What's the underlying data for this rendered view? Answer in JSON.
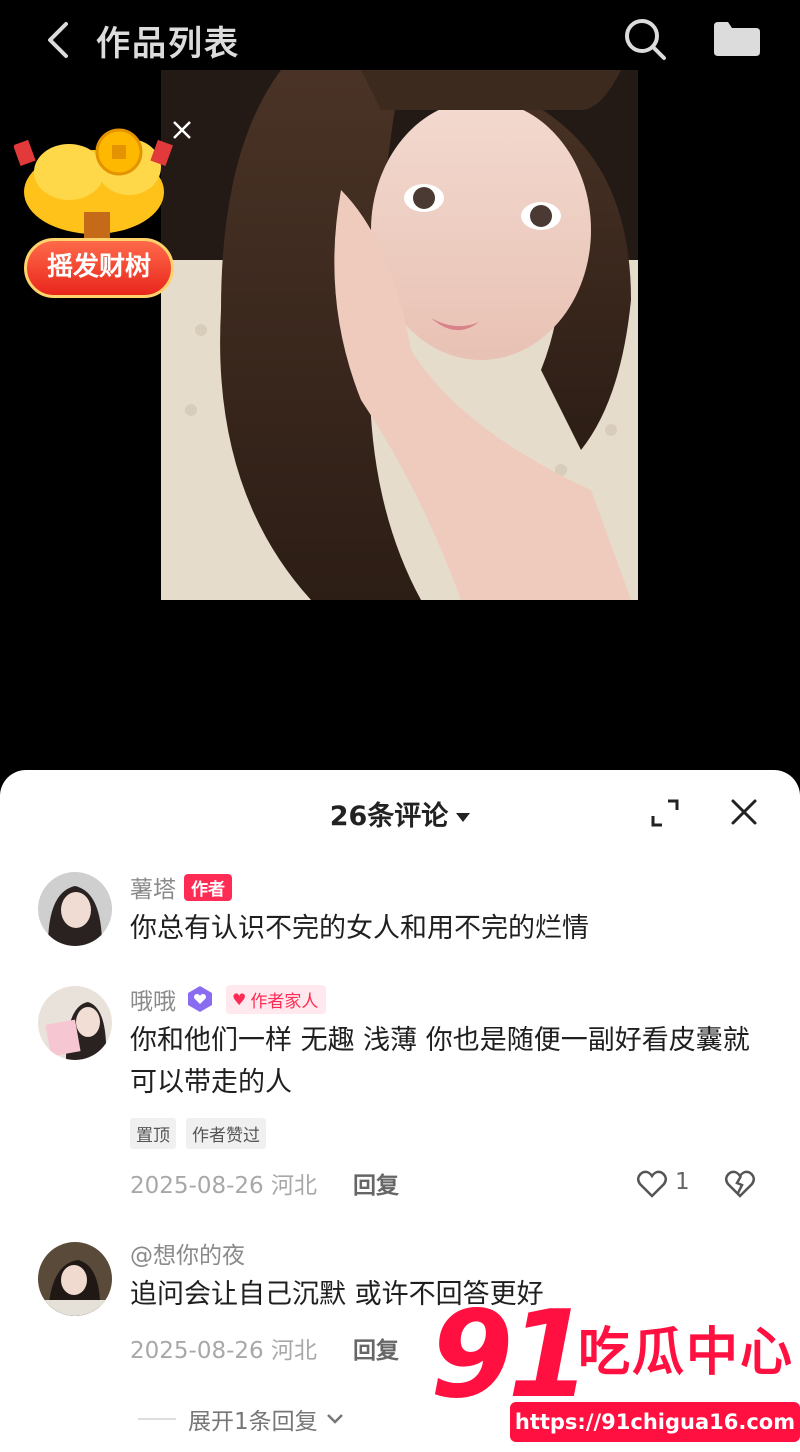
{
  "header": {
    "title": "作品列表",
    "back_icon": "chevron-left-icon",
    "search_icon": "search-icon",
    "more_icon": "menu-icon"
  },
  "promo": {
    "label": "摇发财树",
    "icon": "money-tree-icon"
  },
  "comments_panel": {
    "count_label": "26条评论",
    "comments": [
      {
        "username": "薯塔",
        "author_badge": "作者",
        "text": "你总有认识不完的女人和用不完的烂情"
      },
      {
        "username": "哦哦",
        "family_badge": "作者家人",
        "text": "你和他们一样 无趣 浅薄 你也是随便一副好看皮囊就可以带走的人",
        "tags": [
          "置顶",
          "作者赞过"
        ],
        "date": "2025-08-26 河北",
        "reply_label": "回复",
        "likes": "1"
      },
      {
        "username": "@想你的夜",
        "text": "追问会让自己沉默 或许不回答更好",
        "date": "2025-08-26 河北",
        "reply_label": "回复"
      }
    ],
    "expand_replies_label": "展开1条回复"
  },
  "watermark": {
    "number": "91",
    "text": "吃瓜中心",
    "url": "https://91chigua16.com"
  },
  "colors": {
    "accent": "#fe2c55",
    "background": "#000000",
    "sheet": "#ffffff"
  }
}
